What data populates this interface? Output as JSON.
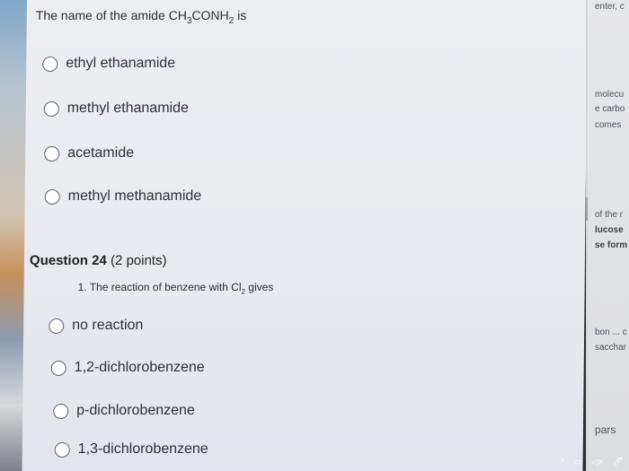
{
  "question23": {
    "prefix": "The name of the amide CH",
    "sub1": "3",
    "mid": "CONH",
    "sub2": "2",
    "suffix": " is",
    "options": [
      "ethyl ethanamide",
      "methyl ethanamide",
      "acetamide",
      "methyl methanamide"
    ]
  },
  "question24": {
    "heading": "Question 24",
    "points": " (2 points)",
    "prompt_prefix": "1. The reaction of benzene with Cl",
    "prompt_sub": "2",
    "prompt_suffix": " gives",
    "options": [
      "no reaction",
      "1,2-dichlorobenzene",
      "p-dichlorobenzene",
      "1,3-dichlorobenzene"
    ]
  },
  "side_panel": {
    "snippets": [
      "enter, c",
      "molecu",
      "e carbo",
      "comes",
      "of the r",
      "lucose",
      "se form",
      "bon ... c",
      "sacchar",
      "pars"
    ]
  },
  "taskbar": {
    "icons": [
      "^",
      "▭",
      "◁×",
      "🖊"
    ]
  }
}
